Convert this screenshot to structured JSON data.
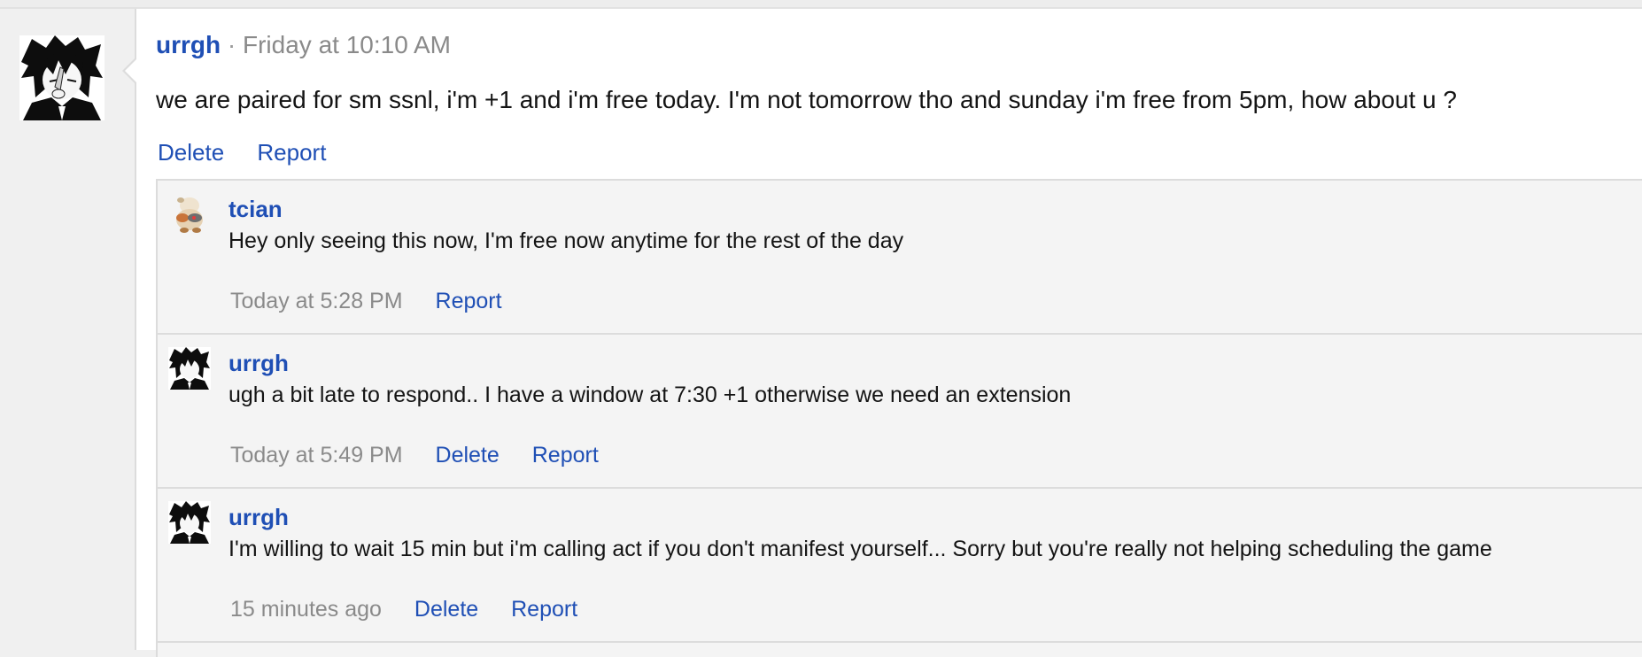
{
  "post": {
    "author": "urrgh",
    "separator": "·",
    "timestamp": "Friday at 10:10 AM",
    "message": "we are paired for sm ssnl, i'm +1 and i'm free today. I'm not tomorrow tho and sunday i'm free from 5pm, how about u ?",
    "actions": {
      "delete": "Delete",
      "report": "Report"
    }
  },
  "comments": [
    {
      "author": "tcian",
      "text": "Hey only seeing this now, I'm free now anytime for the rest of the day",
      "time": "Today at 5:28 PM",
      "report": "Report"
    },
    {
      "author": "urrgh",
      "text": "ugh a bit late to respond.. I have a window at 7:30 +1 otherwise we need an extension",
      "time": "Today at 5:49 PM",
      "delete": "Delete",
      "report": "Report"
    },
    {
      "author": "urrgh",
      "text": "I'm willing to wait 15 min but i'm calling act if you don't manifest yourself... Sorry but you're really not helping scheduling the game",
      "time": "15 minutes ago",
      "delete": "Delete",
      "report": "Report"
    }
  ],
  "colors": {
    "link": "#1f4fb5",
    "meta": "#8a8a8a",
    "text": "#141414"
  },
  "icons": {
    "author_avatar": "anime-avatar-icon",
    "tcian_avatar": "pokemon-avatar-icon"
  }
}
